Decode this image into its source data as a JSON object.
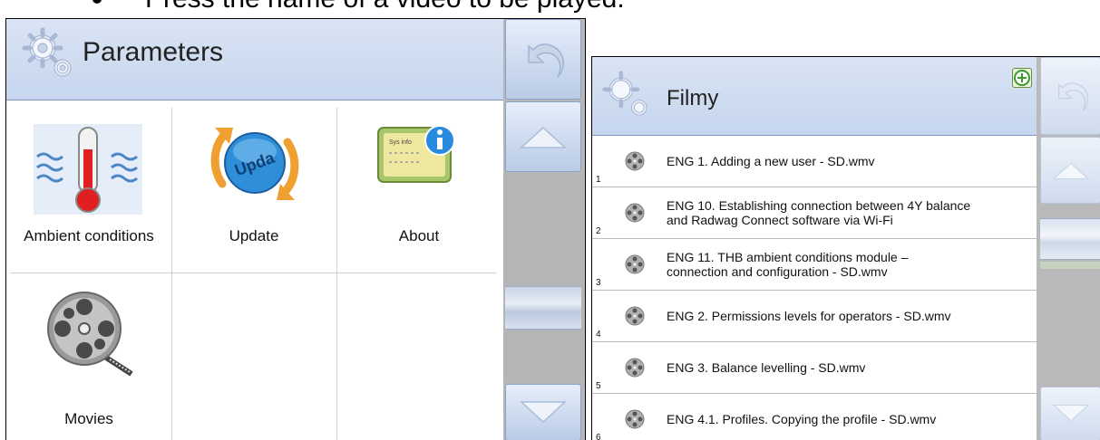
{
  "caption": {
    "text": "Press the name of a video to be played."
  },
  "parameters": {
    "title": "Parameters",
    "tiles": [
      {
        "label": "Ambient conditions",
        "icon": "thermometer-icon"
      },
      {
        "label": "Update",
        "icon": "update-icon"
      },
      {
        "label": "About",
        "icon": "info-card-icon"
      },
      {
        "label": "Movies",
        "icon": "film-reel-icon"
      }
    ],
    "about_icon_text": "Sys info"
  },
  "movies": {
    "title": "Filmy",
    "items": [
      {
        "num": "1",
        "name": "ENG 1. Adding a new user - SD.wmv"
      },
      {
        "num": "2",
        "name": "ENG 10. Establishing connection between 4Y balance and Radwag Connect software via Wi-Fi"
      },
      {
        "num": "3",
        "name": "ENG 11. THB ambient conditions module – connection and configuration - SD.wmv"
      },
      {
        "num": "4",
        "name": "ENG 2. Permissions levels for operators - SD.wmv"
      },
      {
        "num": "5",
        "name": "ENG 3. Balance levelling - SD.wmv"
      },
      {
        "num": "6",
        "name": "ENG 4.1. Profiles. Copying the profile - SD.wmv"
      }
    ]
  },
  "colors": {
    "header_bg": "#c6d6ee",
    "scroll_track": "#b5b5b5",
    "add_button": "#3a9a2a"
  }
}
